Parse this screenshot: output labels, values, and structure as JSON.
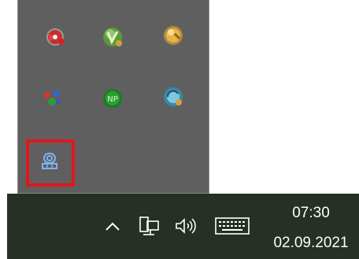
{
  "tray_flyout": {
    "icons": [
      {
        "name": "red-disc-app-icon"
      },
      {
        "name": "green-v-shield-icon"
      },
      {
        "name": "yellow-orb-icon"
      },
      {
        "name": "colored-dots-icon"
      },
      {
        "name": "green-np-icon"
      },
      {
        "name": "blue-sync-icon"
      },
      {
        "name": "blue-monitor-camera-icon"
      }
    ],
    "highlighted_icon": "blue-monitor-camera-icon",
    "highlight_color": "#e0161e"
  },
  "taskbar": {
    "background": "#263024",
    "show_hidden_icons": "chevron-up-icon",
    "network_icon": "network-icon",
    "volume_icon": "speaker-icon",
    "keyboard_icon": "keyboard-icon",
    "clock": {
      "time": "07:30",
      "date": "02.09.2021"
    }
  }
}
